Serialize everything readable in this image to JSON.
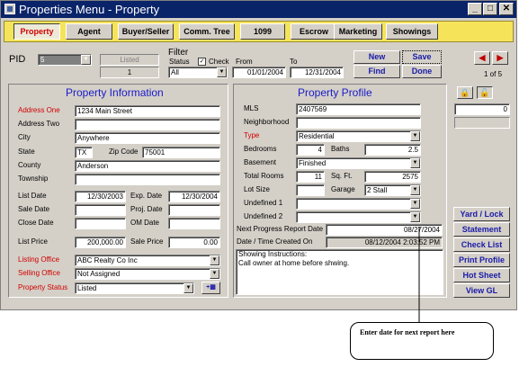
{
  "window": {
    "title": "Properties Menu - Property",
    "minimize": "_",
    "maximize": "□",
    "close": "✕"
  },
  "tabs": [
    {
      "label": "Property"
    },
    {
      "label": "Agent"
    },
    {
      "label": "Buyer/Seller"
    },
    {
      "label": "Comm. Tree"
    },
    {
      "label": "1099"
    },
    {
      "label": "Escrow"
    },
    {
      "label": "Marketing"
    },
    {
      "label": "Showings"
    }
  ],
  "top": {
    "pid_label": "PID",
    "pid_value": "5",
    "listed_label": "Listed",
    "listed_value": "1",
    "filter_label": "Filter",
    "status_label": "Status",
    "status_value": "All",
    "check_label": "Check",
    "from_label": "From",
    "from_value": "01/01/2004",
    "to_label": "To",
    "to_value": "12/31/2004",
    "new": "New",
    "save": "Save",
    "find": "Find",
    "done": "Done",
    "record_of": "1 of 5",
    "counter_value": "0"
  },
  "property_info": {
    "header": "Property Information",
    "address_one_label": "Address One",
    "address_one": "1234 Main Street",
    "address_two_label": "Address Two",
    "address_two": "",
    "city_label": "City",
    "city": "Anywhere",
    "state_label": "State",
    "state": "TX",
    "zip_label": "Zip Code",
    "zip": "75001",
    "county_label": "County",
    "county": "Anderson",
    "township_label": "Township",
    "township": "",
    "list_date_label": "List Date",
    "list_date": "12/30/2003",
    "exp_date_label": "Exp. Date",
    "exp_date": "12/30/2004",
    "sale_date_label": "Sale Date",
    "sale_date": "",
    "proj_date_label": "Proj. Date",
    "proj_date": "",
    "close_date_label": "Close Date",
    "close_date": "",
    "om_date_label": "OM Date",
    "om_date": "",
    "list_price_label": "List Price",
    "list_price": "200,000.00",
    "sale_price_label": "Sale Price",
    "sale_price": "0.00",
    "listing_office_label": "Listing Office",
    "listing_office": "ABC Realty Co Inc",
    "selling_office_label": "Selling Office",
    "selling_office": "Not Assigned",
    "property_status_label": "Property Status",
    "property_status": "Listed"
  },
  "property_profile": {
    "header": "Property Profile",
    "mls_label": "MLS",
    "mls": "2407569",
    "neighborhood_label": "Neighborhood",
    "neighborhood": "",
    "type_label": "Type",
    "type": "Residential",
    "bedrooms_label": "Bedrooms",
    "bedrooms": "4",
    "baths_label": "Baths",
    "baths": "2.5",
    "basement_label": "Basement",
    "basement": "Finished",
    "total_rooms_label": "Total Rooms",
    "total_rooms": "11",
    "sqft_label": "Sq. Ft.",
    "sqft": "2575",
    "lot_size_label": "Lot Size",
    "lot_size": "",
    "garage_label": "Garage",
    "garage": "2 Stall",
    "undefined1_label": "Undefined 1",
    "undefined1": "",
    "undefined2_label": "Undefined 2",
    "undefined2": "",
    "next_report_label": "Next Progress Report Date",
    "next_report": "08/27/2004",
    "created_label": "Date / Time Created On",
    "created": "08/12/2004 2:03:52 PM",
    "notes": "Showing Instructions:\nCall owner at home before shwing."
  },
  "side_buttons": [
    "Yard / Lock",
    "Statement",
    "Check List",
    "Print Profile",
    "Hot Sheet",
    "View GL"
  ],
  "callout": "Enter date for next report here"
}
